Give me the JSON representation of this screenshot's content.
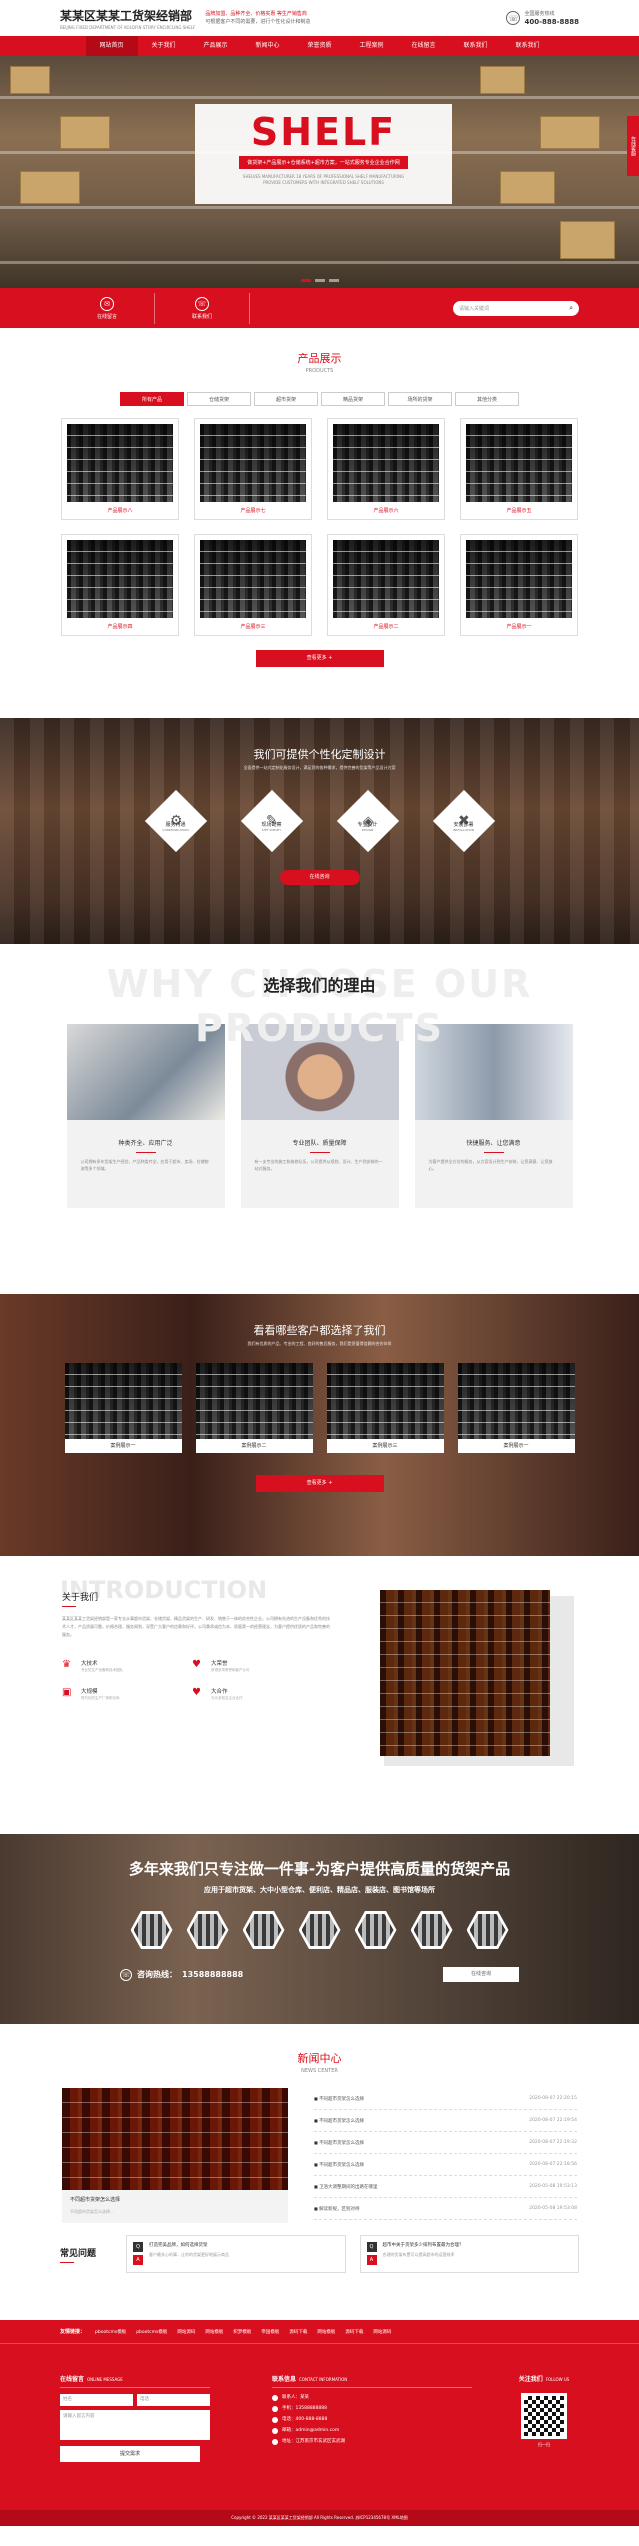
{
  "header": {
    "name": "某某区某某工货架经销部",
    "sub": "BEIJING FIXED DEPARTMENT OF KOLDFIN STORY ENCIRCLING SHELF",
    "slogan1": "品牌加盟、品种齐全、价格实惠 等生产销售商",
    "slogan2": "可根据客户不同的需要，进行个性化设计和制造",
    "hotline_label": "全国服务热线",
    "hotline": "400-888-8888"
  },
  "nav": [
    "网站首页",
    "关于我们",
    "产品展示",
    "新闻中心",
    "荣誉资质",
    "工程案例",
    "在线留言",
    "联系我们",
    "联系我们"
  ],
  "hero": {
    "title": "SHELF",
    "bar": "做货架+产品展示+仓储系统+超市方案，一站式服务专业企业合作网",
    "tagline1": "SHELVES MANUFACTURER 18 YEARS OF PROFESSIONAL SHELF MANUFACTURING",
    "tagline2": "PROVIDE CUSTOMERS WITH INTEGRATED SHELF SOLUTIONS",
    "right_tab": "在线客服"
  },
  "quick": [
    {
      "icon": "chat-icon",
      "glyph": "✉",
      "label": "在线留言"
    },
    {
      "icon": "phone-icon",
      "glyph": "☏",
      "label": "联系我们"
    }
  ],
  "search": {
    "placeholder": "请输入关键词"
  },
  "products": {
    "title": "产品展示",
    "en": "PRODUCTS",
    "tabs": [
      "所有产品",
      "仓储货架",
      "超市货架",
      "精品货架",
      "场所的货架",
      "其他分类"
    ],
    "items": [
      "产品展示八",
      "产品展示七",
      "产品展示六",
      "产品展示五",
      "产品展示四",
      "产品展示三",
      "产品展示二",
      "产品展示一"
    ],
    "more": "查看更多 +"
  },
  "custom": {
    "title": "我们可提供个性化定制设计",
    "sub": "全面提供一站式定制化服务设计，满足您的各种需求，提供完善的货架等产品设计方案",
    "items": [
      {
        "glyph": "⚙",
        "cn": "服务沟通",
        "en": "COMMUNICATION"
      },
      {
        "glyph": "✎",
        "cn": "现场勘察",
        "en": "SITE SURVEY"
      },
      {
        "glyph": "◈",
        "cn": "专业设计",
        "en": "DESIGN"
      },
      {
        "glyph": "✖",
        "cn": "安装部署",
        "en": "INSTALLATION"
      }
    ],
    "btn": "在线咨询"
  },
  "why": {
    "bg": "WHY CHOOSE OUR PRODUCTS",
    "title": "选择我们的理由",
    "cards": [
      {
        "title": "种类齐全、应用广泛",
        "desc": "公司拥有多年货架生产经验，产品种类齐全，应用于超市、卖场、仓储物流等多个领域。"
      },
      {
        "title": "专业团队、质量保障",
        "desc": "有一支专业的施工和维修队伍，公司提供从规划、设计、生产到安装的一站式服务。"
      },
      {
        "title": "快捷服务、让您满意",
        "desc": "为客户提供全方位的服务，从方案设计到生产安装，让您满意、让您放心。"
      }
    ]
  },
  "cases": {
    "title": "看看哪些客户都选择了我们",
    "sub": "我们有优质的产品、专业的工程、良好的售后服务，我们是您值得信赖的合作伙伴",
    "items": [
      "案例展示一",
      "案例展示二",
      "案例展示三",
      "案例展示一"
    ],
    "more": "查看更多 +"
  },
  "about": {
    "bg": "INTRODUCTION",
    "title": "关于我们",
    "text": "某某区某某工货架经销部是一家专业从事超市货架、仓储货架、精品货架的生产、研发、销售于一体的综合性企业。公司拥有先进的生产设备和优秀的技术人才，产品质量可靠，价格合理，服务周到，深受广大客户的信赖和好评。公司秉承诚信为本、质量第一的经营理念，为客户提供优质的产品和完善的服务。",
    "feats": [
      {
        "glyph": "♛",
        "title": "大技术",
        "desc": "专业的生产设备和技术团队"
      },
      {
        "glyph": "♥",
        "title": "大荣誉",
        "desc": "获得多项荣誉和客户认可"
      },
      {
        "glyph": "▣",
        "title": "大规模",
        "desc": "现代化的生产厂房和仓库"
      },
      {
        "glyph": "♥",
        "title": "大合作",
        "desc": "与众多知名企业合作"
      }
    ]
  },
  "mission": {
    "title": "多年来我们只专注做一件事-为客户提供高质量的货架产品",
    "sub": "应用于超市货架、大中小型仓库、便利店、精品店、服装店、图书馆等场所",
    "phone_label": "咨询热线：",
    "phone": "13588888888",
    "btn": "在线咨询"
  },
  "news": {
    "title": "新闻中心",
    "en": "NEWS CENTER",
    "feature_title": "不同超市货架怎么选择",
    "feature_desc": "不同超市货架怎么选择...",
    "items": [
      {
        "t": "不同超市货架怎么选择",
        "d": "2020-08-07 22:20:15"
      },
      {
        "t": "不同超市货架怎么选择",
        "d": "2020-08-07 22:19:54"
      },
      {
        "t": "不同超市货架怎么选择",
        "d": "2020-08-07 22:19:32"
      },
      {
        "t": "不同超市货架怎么选择",
        "d": "2020-08-07 22:18:56"
      },
      {
        "t": "卫浴大调整期间的出路在哪里",
        "d": "2020-05-08 19:53:13"
      },
      {
        "t": "解读新规，区别对待",
        "d": "2020-05-08 19:53:08"
      }
    ]
  },
  "faq": {
    "title": "常见问题",
    "items": [
      {
        "q": "打造完美品牌，如何选择货架",
        "a": "客户最关心的事，让你的货架更好地展示商品"
      },
      {
        "q": "超市中关于货架多少排列布置最为合理？",
        "a": "合理的货架布置可以提高超市的运营效率"
      }
    ]
  },
  "links": {
    "label": "友情链接：",
    "items": [
      "pbootcms模板",
      "pbootcms模板",
      "网站源码",
      "网站模板",
      "织梦模板",
      "帝国模板",
      "源码下载",
      "网站模板",
      "源码下载",
      "网站源码"
    ]
  },
  "footer": {
    "msg_title": "在线留言",
    "msg_en": "ONLINE MESSAGE",
    "name_ph": "姓名",
    "phone_ph": "电话",
    "content_ph": "请输入留言内容",
    "submit": "提交需求",
    "contact_title": "联系信息",
    "contact_en": "CONTACT INFORMATION",
    "contacts": [
      "联系人：某某",
      "手机：13588888888",
      "电话：400-888-8888",
      "邮箱：admin@admin.com",
      "地址：江苏南京市玄武区玄武湖"
    ],
    "follow_title": "关注我们",
    "follow_en": "FOLLOW US",
    "qr_cap": "扫一扫"
  },
  "copyright": "Copyright © 2022 某某区某某工货架经销部 All Rights Reserved. 苏ICP12345678号 XML地图"
}
